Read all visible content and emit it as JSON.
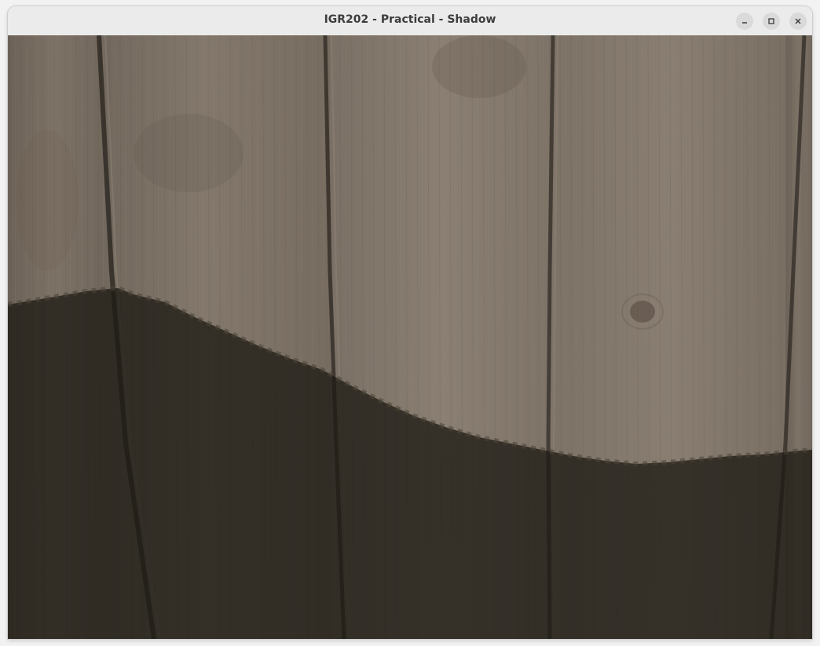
{
  "window": {
    "title": "IGR202 - Practical - Shadow",
    "controls": {
      "minimize_icon": "minimize-icon",
      "maximize_icon": "maximize-icon",
      "close_icon": "close-icon"
    }
  },
  "scene": {
    "description_icon": "wood-plank-wall",
    "colors": {
      "wood_light": "#7e7367",
      "wood_mid": "#6f655a",
      "wood_dark_seam": "#2f2a24",
      "shadow": "#2d2a23"
    }
  }
}
